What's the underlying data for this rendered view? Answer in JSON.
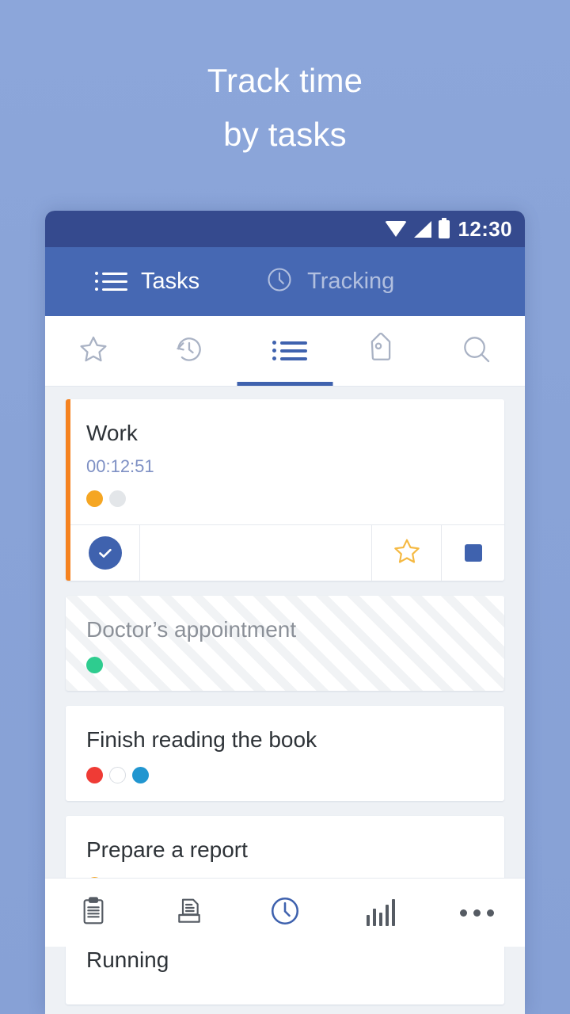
{
  "promo": {
    "line1": "Track time",
    "line2": "by tasks",
    "background_color": "#8aa4d8",
    "text_color": "#ffffff"
  },
  "status_bar": {
    "time": "12:30",
    "icons": [
      "wifi-icon",
      "signal-icon",
      "battery-icon"
    ],
    "background_color": "#354a8e"
  },
  "app_bar": {
    "background_color": "#4668b3",
    "tabs": [
      {
        "label": "Tasks",
        "icon": "list-icon",
        "active": true
      },
      {
        "label": "Tracking",
        "icon": "clock-icon",
        "active": false
      }
    ]
  },
  "tab_bar": {
    "active_color": "#3f62ae",
    "inactive_color": "#a9b2c4",
    "tabs": [
      {
        "icon": "star-icon",
        "name": "favorites",
        "active": false
      },
      {
        "icon": "history-icon",
        "name": "history",
        "active": false
      },
      {
        "icon": "list-icon",
        "name": "all-tasks",
        "active": true
      },
      {
        "icon": "tag-icon",
        "name": "tags",
        "active": false
      },
      {
        "icon": "search-icon",
        "name": "search",
        "active": false
      }
    ]
  },
  "task_list": {
    "background_color": "#eef1f5",
    "tasks": [
      {
        "title": "Work",
        "timer": "00:12:51",
        "running": true,
        "accent_color": "#f5821f",
        "striped": false,
        "dots": [
          "#f5a623",
          "#e3e6e9"
        ],
        "actions": [
          {
            "name": "complete-task-button",
            "icon": "check-circle-icon"
          },
          {
            "name": "task-action-spacer",
            "icon": ""
          },
          {
            "name": "favorite-task-button",
            "icon": "star-icon"
          },
          {
            "name": "stop-timer-button",
            "icon": "stop-square-icon"
          }
        ]
      },
      {
        "title": "Doctor’s appointment",
        "timer": "",
        "running": false,
        "accent_color": "",
        "striped": true,
        "dots": [
          "#2ecc8f"
        ],
        "actions": []
      },
      {
        "title": "Finish reading the book",
        "timer": "",
        "running": false,
        "accent_color": "",
        "striped": false,
        "dots": [
          "#ef3b35",
          "empty",
          "#2196d0"
        ],
        "actions": []
      },
      {
        "title": "Prepare a report",
        "timer": "",
        "running": false,
        "accent_color": "",
        "striped": false,
        "dots": [
          "#f5a623"
        ],
        "actions": []
      },
      {
        "title": "Running",
        "timer": "",
        "running": false,
        "accent_color": "",
        "striped": false,
        "dots": [],
        "actions": []
      }
    ]
  },
  "bottom_nav": {
    "active_color": "#3f62ae",
    "inactive_color": "#555b63",
    "items": [
      {
        "name": "clipboard",
        "icon": "clipboard-icon",
        "active": false
      },
      {
        "name": "documents",
        "icon": "inbox-document-icon",
        "active": false
      },
      {
        "name": "timer",
        "icon": "clock-icon",
        "active": true
      },
      {
        "name": "reports",
        "icon": "bar-chart-icon",
        "active": false
      },
      {
        "name": "more",
        "icon": "more-horizontal-icon",
        "active": false
      }
    ]
  }
}
